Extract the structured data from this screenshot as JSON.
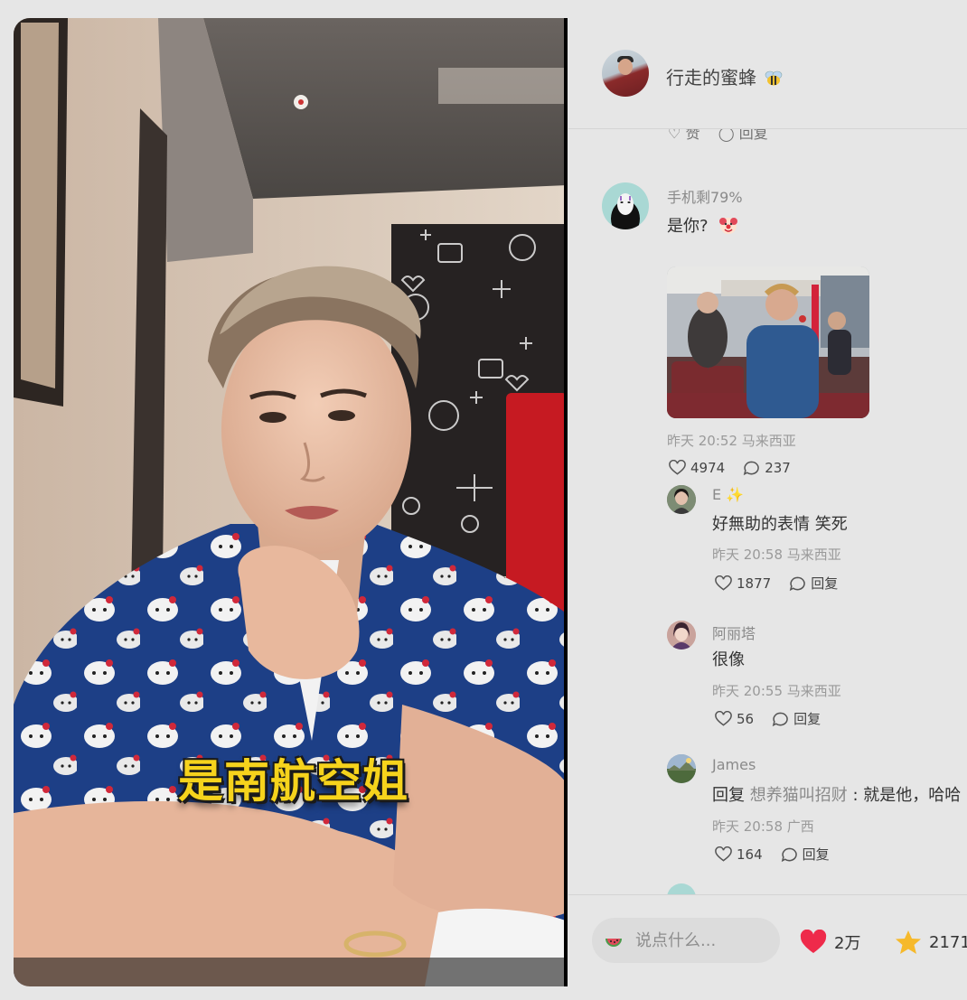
{
  "video": {
    "caption": "是南航空姐"
  },
  "author": {
    "name": "行走的蜜蜂"
  },
  "cut_row": {
    "like": "赞",
    "reply": "回复"
  },
  "comments": [
    {
      "name": "手机剩79%",
      "text": "是你?",
      "meta": "昨天 20:52 马来西亚",
      "likes": "4974",
      "replies": "237"
    },
    {
      "name": "E",
      "text": "好無助的表情 笑死",
      "meta": "昨天 20:58 马来西亚",
      "likes": "1877",
      "reply_label": "回复"
    },
    {
      "name": "阿丽塔",
      "text": "很像",
      "meta": "昨天 20:55 马来西亚",
      "likes": "56",
      "reply_label": "回复"
    },
    {
      "name": "James",
      "reply_prefix": "回复",
      "reply_to": "想养猫叫招财",
      "text": " : 就是他，哈哈",
      "meta": "昨天 20:58 广西",
      "likes": "164",
      "reply_label": "回复"
    }
  ],
  "bottom": {
    "placeholder": "说点什么...",
    "likes": "2万",
    "favorites": "2171"
  },
  "colors": {
    "heart": "#ee2a4a",
    "star": "#f6b92b",
    "caption": "#f6d31c"
  }
}
